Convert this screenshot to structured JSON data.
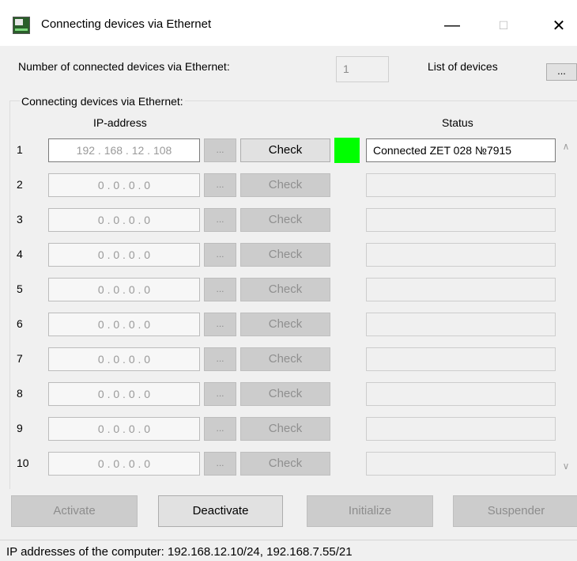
{
  "window": {
    "title": "Connecting devices via Ethernet",
    "minimize": "—",
    "maximize": "☐",
    "close": "✕"
  },
  "top": {
    "num_label": "Number of connected devices via Ethernet:",
    "num_value": "1",
    "list_label": "List of devices",
    "list_button": "..."
  },
  "group": {
    "title": "Connecting devices via Ethernet:",
    "ip_header": "IP-address",
    "status_header": "Status"
  },
  "rows": [
    {
      "num": "1",
      "ip": [
        "192",
        "168",
        "12",
        "108"
      ],
      "check": "Check",
      "dots": "...",
      "status": "Connected ZET 028 №7915",
      "active": true,
      "indicator": "#00ff00"
    },
    {
      "num": "2",
      "ip": [
        "0",
        "0",
        "0",
        "0"
      ],
      "check": "Check",
      "dots": "...",
      "status": "",
      "active": false
    },
    {
      "num": "3",
      "ip": [
        "0",
        "0",
        "0",
        "0"
      ],
      "check": "Check",
      "dots": "...",
      "status": "",
      "active": false
    },
    {
      "num": "4",
      "ip": [
        "0",
        "0",
        "0",
        "0"
      ],
      "check": "Check",
      "dots": "...",
      "status": "",
      "active": false
    },
    {
      "num": "5",
      "ip": [
        "0",
        "0",
        "0",
        "0"
      ],
      "check": "Check",
      "dots": "...",
      "status": "",
      "active": false
    },
    {
      "num": "6",
      "ip": [
        "0",
        "0",
        "0",
        "0"
      ],
      "check": "Check",
      "dots": "...",
      "status": "",
      "active": false
    },
    {
      "num": "7",
      "ip": [
        "0",
        "0",
        "0",
        "0"
      ],
      "check": "Check",
      "dots": "...",
      "status": "",
      "active": false
    },
    {
      "num": "8",
      "ip": [
        "0",
        "0",
        "0",
        "0"
      ],
      "check": "Check",
      "dots": "...",
      "status": "",
      "active": false
    },
    {
      "num": "9",
      "ip": [
        "0",
        "0",
        "0",
        "0"
      ],
      "check": "Check",
      "dots": "...",
      "status": "",
      "active": false
    },
    {
      "num": "10",
      "ip": [
        "0",
        "0",
        "0",
        "0"
      ],
      "check": "Check",
      "dots": "...",
      "status": "",
      "active": false
    }
  ],
  "scroll": {
    "up": "∧",
    "down": "∨"
  },
  "buttons": {
    "activate": "Activate",
    "deactivate": "Deactivate",
    "initialize": "Initialize",
    "suspender": "Suspender"
  },
  "statusbar": "IP addresses of the computer: 192.168.12.10/24, 192.168.7.55/21"
}
